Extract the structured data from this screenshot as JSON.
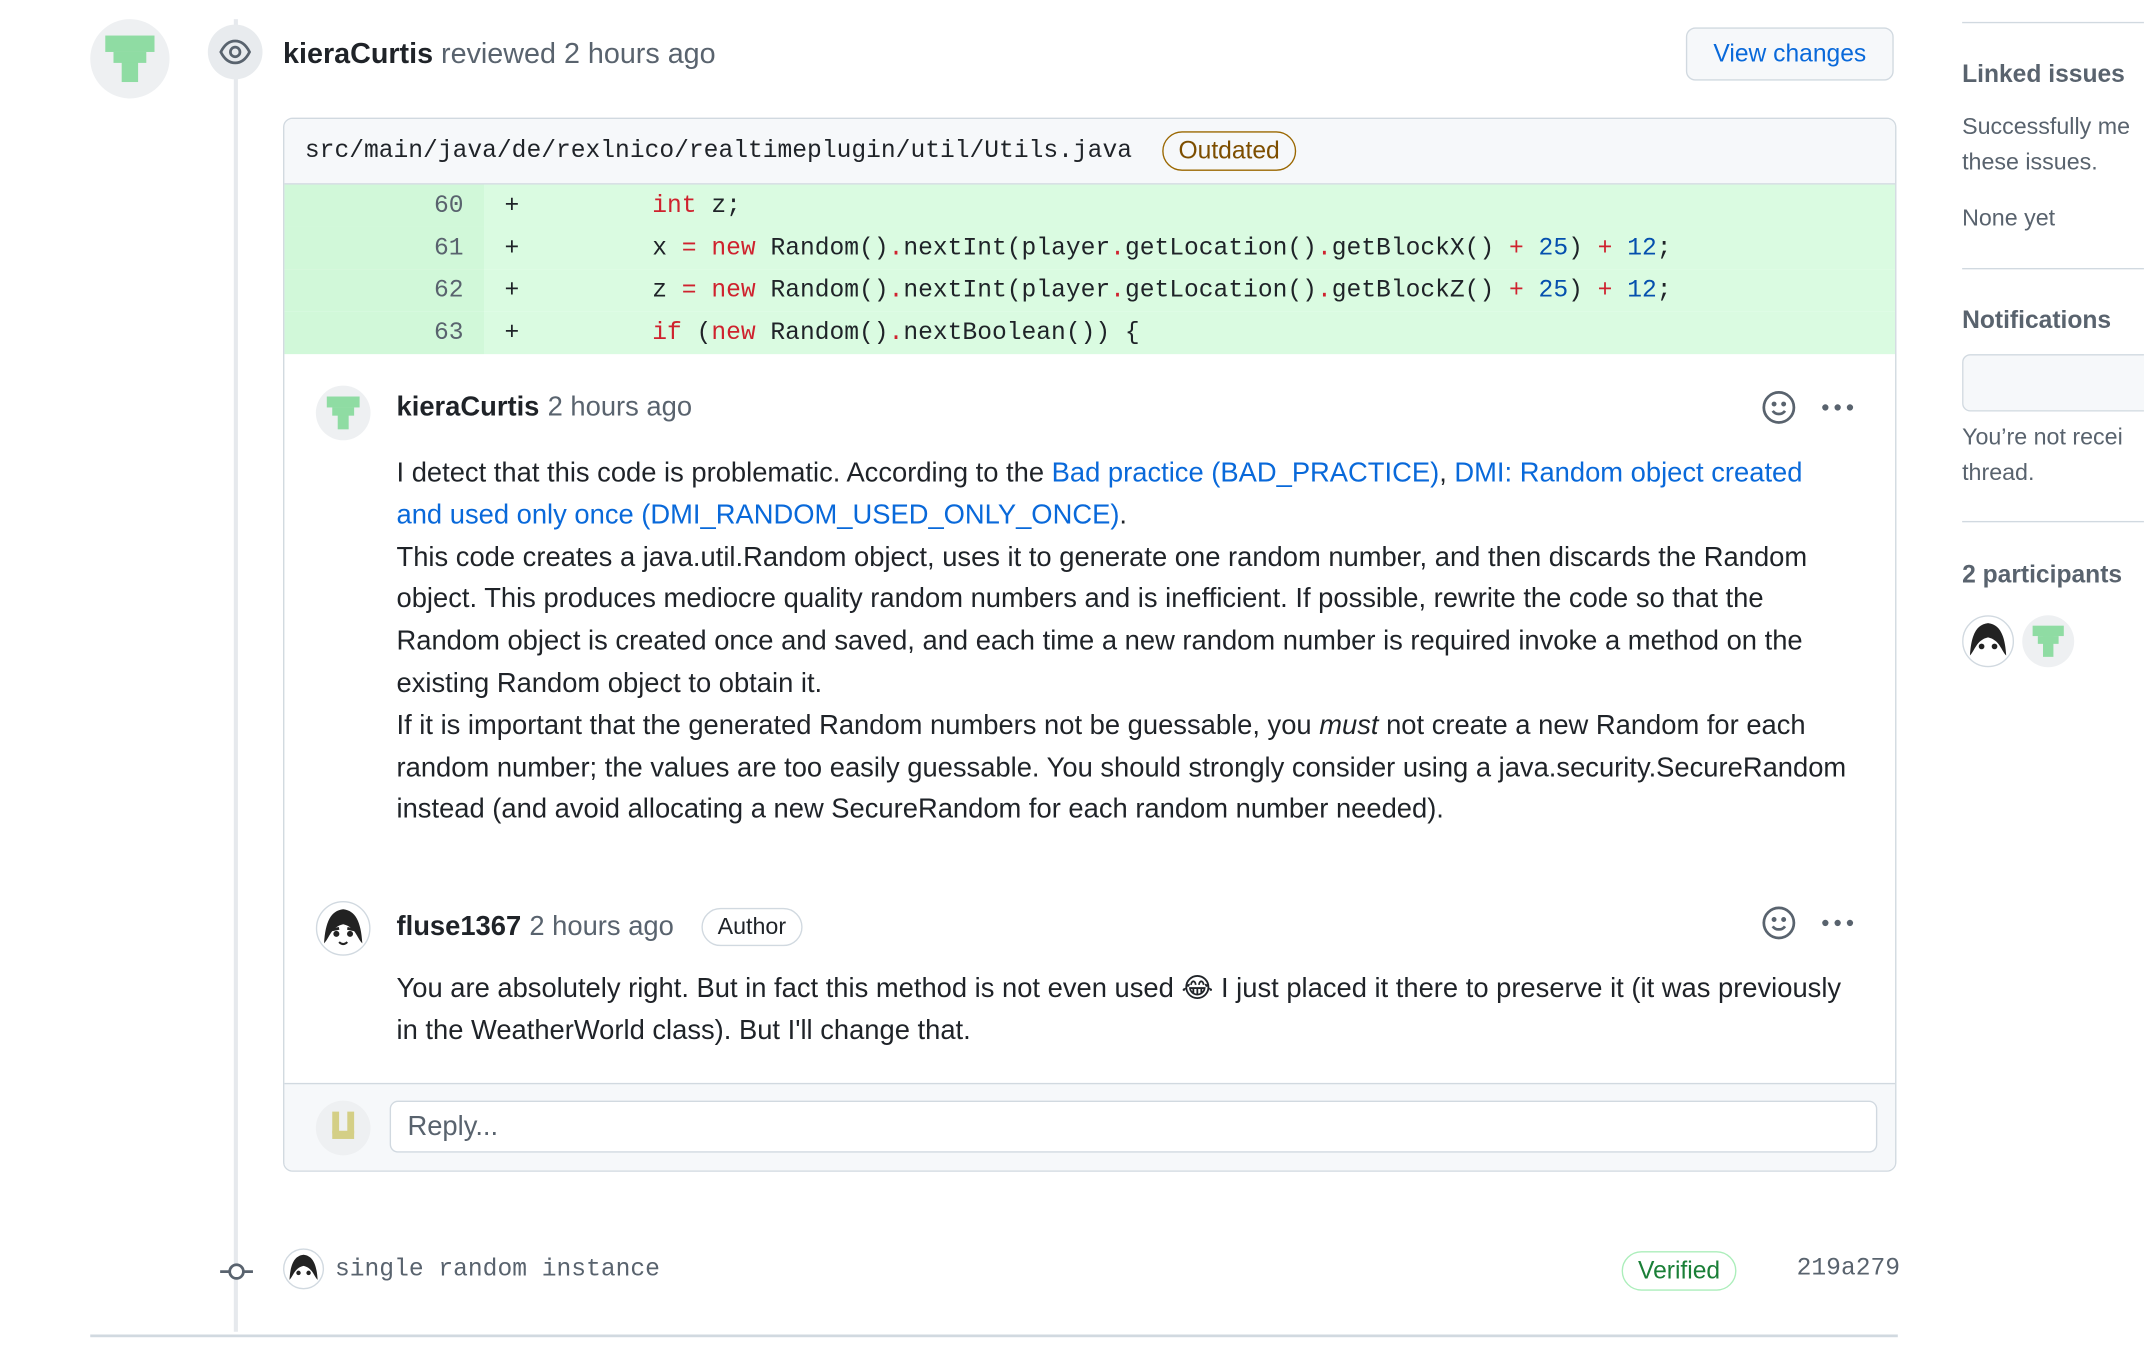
{
  "review": {
    "reviewer": "kieraCurtis",
    "action": "reviewed",
    "time": "2 hours ago",
    "view_changes_label": "View changes"
  },
  "file": {
    "path": "src/main/java/de/rexlnico/realtimeplugin/util/Utils.java",
    "status_badge": "Outdated"
  },
  "diff": {
    "lines": [
      {
        "num": "60",
        "sign": "+"
      },
      {
        "num": "61",
        "sign": "+"
      },
      {
        "num": "62",
        "sign": "+"
      },
      {
        "num": "63",
        "sign": "+"
      }
    ]
  },
  "comments": [
    {
      "author": "kieraCurtis",
      "time": "2 hours ago",
      "intro": "I detect that this code is problematic. According to the ",
      "link1": "Bad practice (BAD_PRACTICE)",
      "sep": ", ",
      "link2": "DMI: Random object created and used only once (DMI_RANDOM_USED_ONLY_ONCE)",
      "end": ".",
      "para2": "This code creates a java.util.Random object, uses it to generate one random number, and then discards the Random object. This produces mediocre quality random numbers and is inefficient. If possible, rewrite the code so that the Random object is created once and saved, and each time a new random number is required invoke a method on the existing Random object to obtain it.",
      "para3a": "If it is important that the generated Random numbers not be guessable, you ",
      "para3em": "must",
      "para3b": " not create a new Random for each random number; the values are too easily guessable. You should strongly consider using a java.security.SecureRandom instead (and avoid allocating a new SecureRandom for each random number needed)."
    },
    {
      "author": "fluse1367",
      "time": "2 hours ago",
      "badge": "Author",
      "text_a": "You are absolutely right. But in fact this method is not even used ",
      "emoji": "😂",
      "text_b": " I just placed it there to preserve it (it was previously in the WeatherWorld class). But I'll change that."
    }
  ],
  "reply": {
    "placeholder": "Reply..."
  },
  "commit": {
    "message": "single random instance",
    "verified": "Verified",
    "sha": "219a279"
  },
  "sidebar": {
    "linked_issues": {
      "title": "Linked issues",
      "line1": "Successfully me",
      "line2": "these issues.",
      "none": "None yet"
    },
    "notifications": {
      "title": "Notifications",
      "line1": "You’re not recei",
      "line2": "thread."
    },
    "participants": {
      "title": "2 participants"
    }
  },
  "colors": {
    "accent": "#0969da",
    "diff_add": "#dafbe1",
    "verified": "#1a7f37",
    "outdated": "#9a6700"
  },
  "icons": [
    "eye-icon",
    "smiley-icon",
    "kebab-icon",
    "commit-icon"
  ]
}
